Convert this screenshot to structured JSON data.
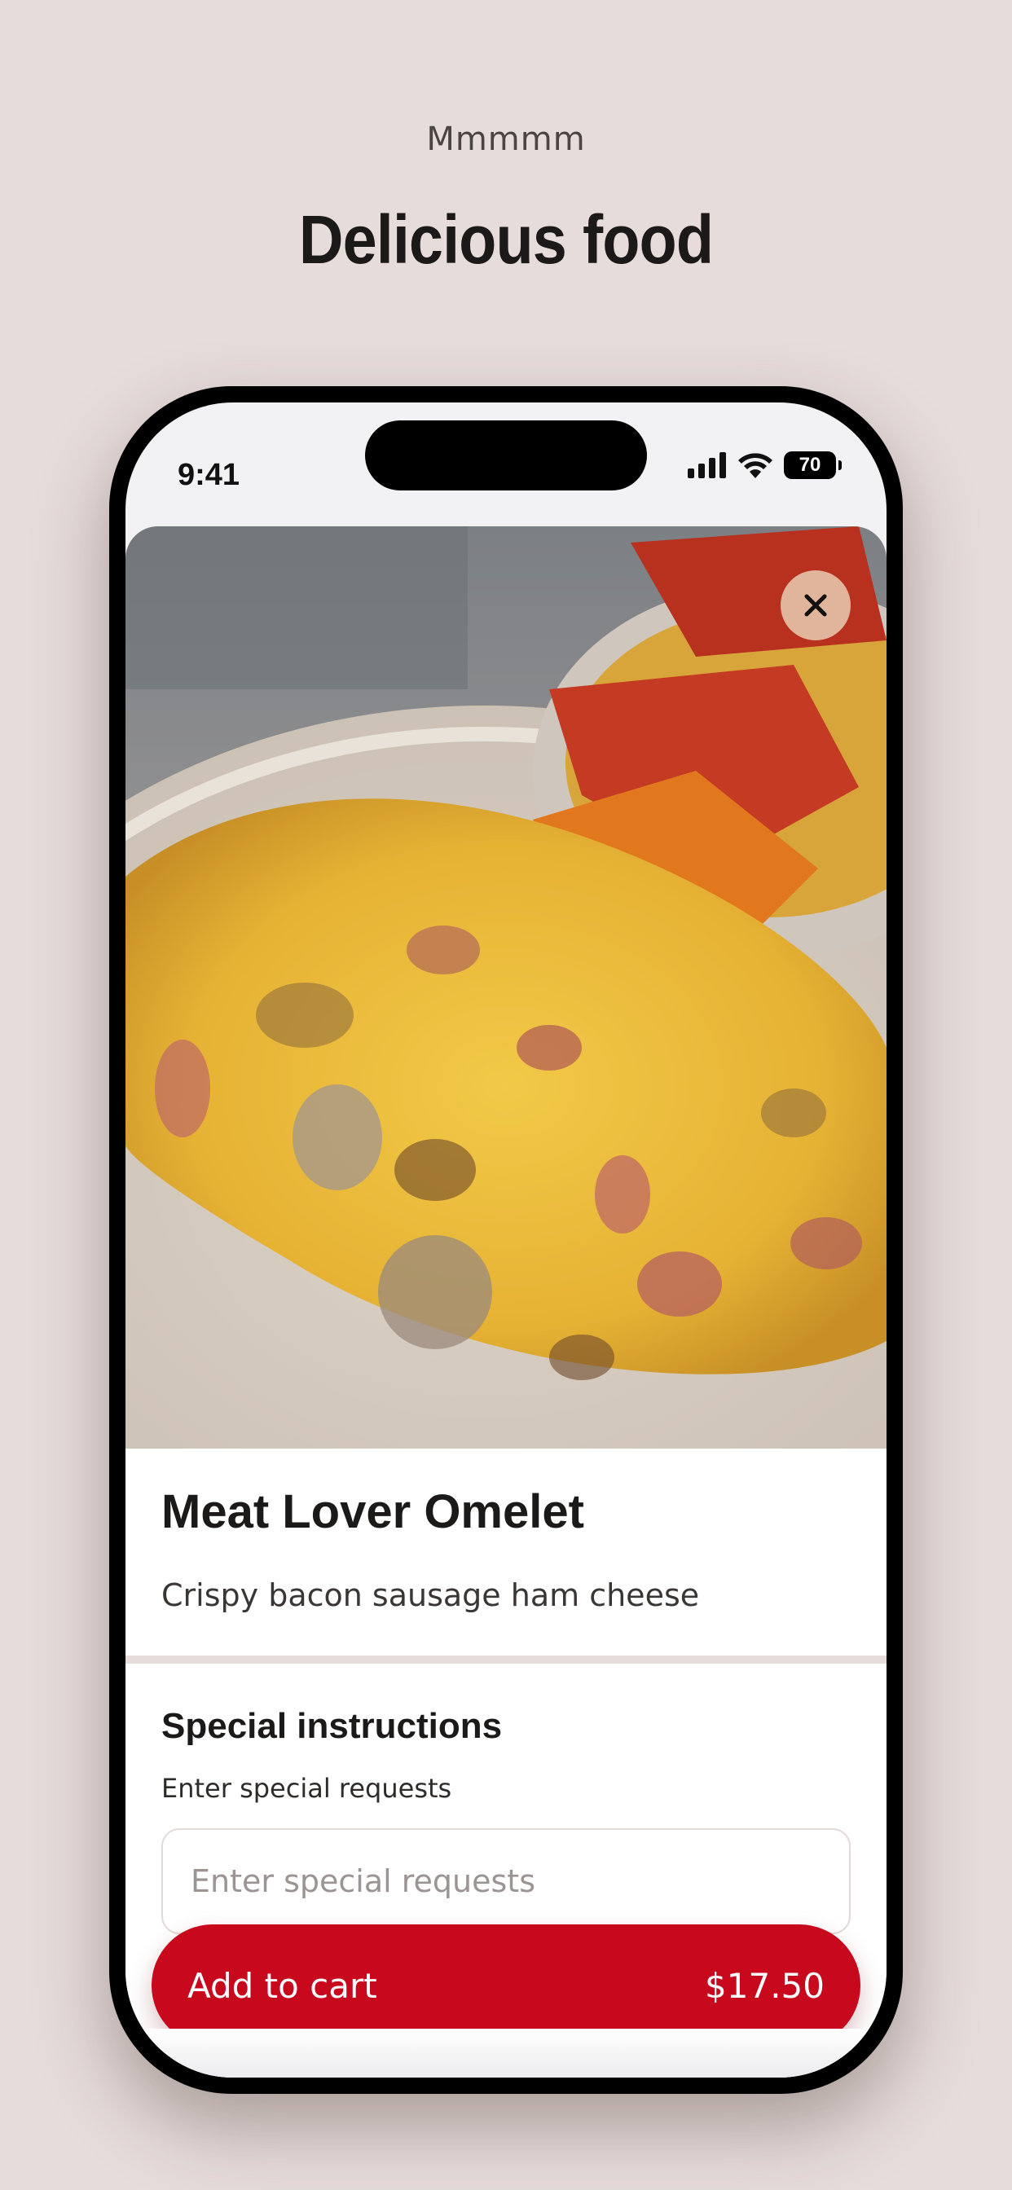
{
  "header": {
    "kicker": "Mmmmm",
    "title": "Delicious food"
  },
  "status_bar": {
    "time": "9:41",
    "battery": "70",
    "icons": [
      "signal-icon",
      "wifi-icon",
      "battery-icon"
    ]
  },
  "item": {
    "photo": "omelet-photo",
    "name": "Meat Lover Omelet",
    "description": "Crispy bacon sausage ham cheese"
  },
  "special_instructions": {
    "title": "Special instructions",
    "subtitle": "Enter special requests",
    "placeholder": "Enter special requests",
    "value": ""
  },
  "cart": {
    "label": "Add to cart",
    "price": "$17.50"
  },
  "colors": {
    "background": "#e6dcda",
    "accent": "#c8081c",
    "close_button": "#e4c4aa"
  }
}
